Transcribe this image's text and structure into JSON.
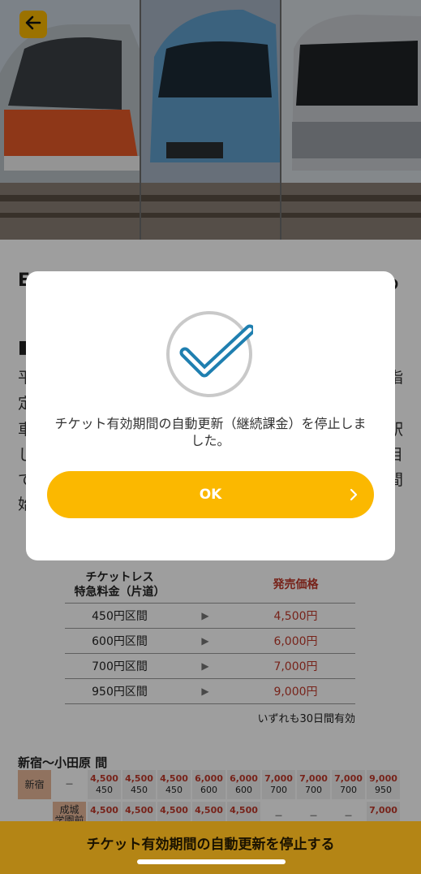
{
  "hero": {
    "alt": "Romancecar trains"
  },
  "header": {
    "back_icon": "arrow-left-icon"
  },
  "background": {
    "heading_fragment": "E",
    "heading_fragment_right": "つ",
    "paragraph_chars": [
      "平",
      "定",
      "車",
      "し",
      "で",
      "始"
    ],
    "paragraph_chars_right": [
      "指",
      "",
      "駅",
      "目",
      "間",
      ""
    ]
  },
  "price_table": {
    "header_col1": "チケットレス\n特急料金（片道）",
    "header_col3": "発売価格",
    "rows": [
      {
        "section": "450円区間",
        "price": "4,500円"
      },
      {
        "section": "600円区間",
        "price": "6,000円"
      },
      {
        "section": "700円区間",
        "price": "7,000円"
      },
      {
        "section": "950円区間",
        "price": "9,000円"
      }
    ],
    "note": "いずれも30日間有効"
  },
  "route": {
    "title": "新宿～小田原 間",
    "row1": [
      {
        "station": "新宿"
      },
      {
        "dash": "－"
      },
      {
        "top": "4,500",
        "bot": "450"
      },
      {
        "top": "4,500",
        "bot": "450"
      },
      {
        "top": "4,500",
        "bot": "450"
      },
      {
        "top": "6,000",
        "bot": "600"
      },
      {
        "top": "6,000",
        "bot": "600"
      },
      {
        "top": "7,000",
        "bot": "700"
      },
      {
        "top": "7,000",
        "bot": "700"
      },
      {
        "top": "7,000",
        "bot": "700"
      },
      {
        "top": "9,000",
        "bot": "950"
      }
    ],
    "row2": [
      {
        "blank": ""
      },
      {
        "station": "成城\n学園前"
      },
      {
        "top": "4,500",
        "bot": ""
      },
      {
        "top": "4,500",
        "bot": ""
      },
      {
        "top": "4,500",
        "bot": ""
      },
      {
        "top": "4,500",
        "bot": ""
      },
      {
        "top": "4,500",
        "bot": ""
      },
      {
        "dash": "－"
      },
      {
        "dash": "－"
      },
      {
        "dash": "－"
      },
      {
        "top": "7,000",
        "bot": ""
      }
    ]
  },
  "dialog": {
    "icon": "check-circle-icon",
    "message": "チケット有効期間の自動更新（継続課金）を停止しました。",
    "ok_label": "OK",
    "ok_icon": "chevron-right-icon"
  },
  "bottom_bar": {
    "label": "チケット有効期間の自動更新を停止する"
  },
  "colors": {
    "accent": "#fbb800",
    "price_red": "#c0392b",
    "bottom_bar": "#b48515"
  }
}
